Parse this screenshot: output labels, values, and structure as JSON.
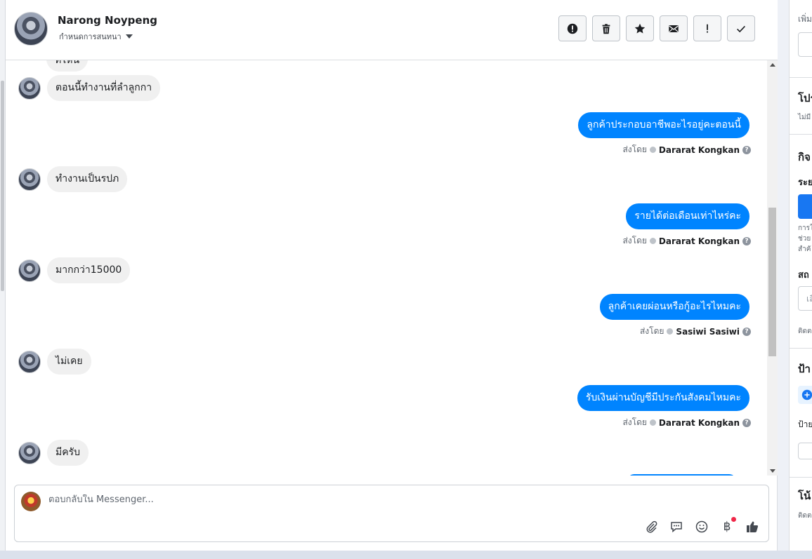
{
  "header": {
    "contact_name": "Narong Noypeng",
    "assign_label": "กำหนดการสนทนา",
    "actions": [
      {
        "name": "mark-spam-button",
        "icon": "alert-circle-icon"
      },
      {
        "name": "delete-button",
        "icon": "trash-icon"
      },
      {
        "name": "star-button",
        "icon": "star-icon"
      },
      {
        "name": "mark-unread-button",
        "icon": "envelope-icon"
      },
      {
        "name": "follow-up-button",
        "icon": "exclamation-icon"
      },
      {
        "name": "mark-done-button",
        "icon": "check-icon"
      }
    ]
  },
  "messages": {
    "partial_top_text": "ที่ไหน",
    "items": [
      {
        "dir": "in",
        "text": "ตอนนี้ทำงานที่ลำลูกกา"
      },
      {
        "dir": "out",
        "text": "ลูกค้าประกอบอาชีพอะไรอยู่คะตอนนี้",
        "sent_by_label": "ส่งโดย",
        "agent": "Dararat Kongkan"
      },
      {
        "dir": "in",
        "text": "ทำงานเป็นรปภ"
      },
      {
        "dir": "out",
        "text": "รายได้ต่อเดือนเท่าไหร่คะ",
        "sent_by_label": "ส่งโดย",
        "agent": "Dararat Kongkan"
      },
      {
        "dir": "in",
        "text": "มากกว่า15000"
      },
      {
        "dir": "out",
        "text": "ลูกค้าเคยผ่อนหรือกู้อะไรไหมคะ",
        "sent_by_label": "ส่งโดย",
        "agent": "Sasiwi Sasiwi"
      },
      {
        "dir": "in",
        "text": "ไม่เคย"
      },
      {
        "dir": "out",
        "text": "รับเงินผ่านบัญชีมีประกันสังคมไหมคะ",
        "sent_by_label": "ส่งโดย",
        "agent": "Dararat Kongkan"
      },
      {
        "dir": "in",
        "text": "มีครับ"
      }
    ]
  },
  "composer": {
    "placeholder": "ตอบกลับใน Messenger...",
    "baht_symbol": "฿"
  },
  "right_panel": {
    "add_label": "เพิ่ม",
    "profile_title": "โปร",
    "profile_sub": "ไม่มี",
    "activity_title": "กิจ",
    "period_label": "ระย",
    "desc_lines": [
      "การใ",
      "ช่วย",
      "สำคั"
    ],
    "status_label": "สถ",
    "field_hint": "เลื",
    "contact_hint": "ติดต",
    "labels_title": "ป้า",
    "labels_sub": "ป้าย",
    "notes_title": "โน้",
    "notes_sub": "ติดต"
  },
  "colors": {
    "outgoing_bubble": "#0084ff",
    "incoming_bubble": "#f0f0f0",
    "badge": "#f02849"
  }
}
